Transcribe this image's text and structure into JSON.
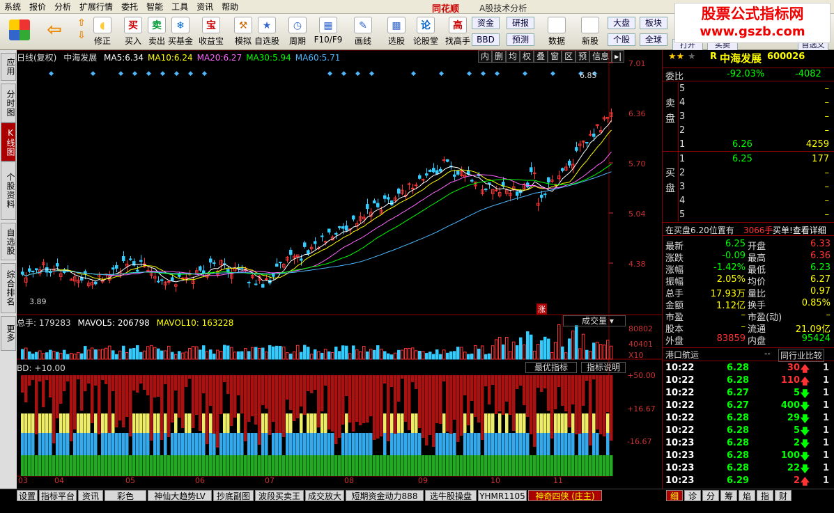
{
  "menu": [
    "系统",
    "报价",
    "分析",
    "扩展行情",
    "委托",
    "智能",
    "工具",
    "资讯",
    "帮助"
  ],
  "brand": "同花顺",
  "title": "A股技术分析",
  "watermark": {
    "line1": "股票公式指标网",
    "line2": "www.gszb.com"
  },
  "toolbar": [
    "修正",
    "买入",
    "卖出",
    "买基金",
    "收益宝",
    "模拟",
    "自选股",
    "周期",
    "F10/F9",
    "画线",
    "选股",
    "论股堂",
    "找高手",
    "数据",
    "新股"
  ],
  "side_buttons": [
    "资金",
    "研报",
    "BBD",
    "预测",
    "大盘",
    "个股",
    "板块",
    "全球",
    "打开",
    "买卖",
    "自选义"
  ],
  "left_tabs": [
    "应用",
    "分时图",
    "K线图",
    "个股资料",
    "自选股",
    "综合排名",
    "更多"
  ],
  "chart": {
    "period": "日线(复权)",
    "stock": "中海发展",
    "ma": [
      {
        "k": "MA5:",
        "v": "6.34",
        "c": "#ffffff"
      },
      {
        "k": "MA10:",
        "v": "6.24",
        "c": "#ffff00"
      },
      {
        "k": "MA20:",
        "v": "6.27",
        "c": "#ff66ff"
      },
      {
        "k": "MA30:",
        "v": "5.94",
        "c": "#00ff00"
      },
      {
        "k": "MA60:",
        "v": "5.71",
        "c": "#4db8ff"
      }
    ],
    "tools": [
      "内",
      "删",
      "均",
      "权",
      "叠",
      "窗",
      "区",
      "预",
      "信息"
    ],
    "price_ticks": [
      "7.01",
      "6.36",
      "5.70",
      "5.04",
      "4.38"
    ],
    "high": "6.85",
    "low": "3.89",
    "vol_label": "总手: 179283",
    "vol_ma5": "MAVOL5: 206798",
    "vol_ma10": "MAVOL10: 163228",
    "vol_btn": "成交量",
    "vol_ticks": [
      "80802",
      "40401",
      "X10"
    ],
    "bd_label": "BD: +10.00",
    "bd_ticks": [
      "+50.00",
      "+16.67",
      "-16.67"
    ],
    "bd_btns": [
      "最优指标",
      "指标说明"
    ],
    "zhang": "涨",
    "months": [
      "03",
      "04",
      "05",
      "06",
      "07",
      "08",
      "09",
      "10",
      "11"
    ]
  },
  "quote": {
    "name": "中海发展",
    "code": "600026",
    "prefix": "R",
    "weibi": {
      "k": "委比",
      "v": "-92.03%",
      "d": "-4082"
    },
    "sell_label": "卖盘",
    "buy_label": "买盘",
    "sell": [
      {
        "n": "5",
        "p": "",
        "v": "–"
      },
      {
        "n": "4",
        "p": "",
        "v": "–"
      },
      {
        "n": "3",
        "p": "",
        "v": "–"
      },
      {
        "n": "2",
        "p": "",
        "v": "–"
      },
      {
        "n": "1",
        "p": "6.26",
        "v": "4259"
      }
    ],
    "buy": [
      {
        "n": "1",
        "p": "6.25",
        "v": "177"
      },
      {
        "n": "2",
        "p": "",
        "v": "–"
      },
      {
        "n": "3",
        "p": "",
        "v": "–"
      },
      {
        "n": "4",
        "p": "",
        "v": "–"
      },
      {
        "n": "5",
        "p": "",
        "v": "–"
      }
    ],
    "notice": {
      "a": "在买盘6.20位置有",
      "b": "3066手",
      "c": "买单!查看详细"
    },
    "stats": [
      {
        "k1": "最新",
        "v1": "6.25",
        "k2": "开盘",
        "v2": "6.33",
        "c1": "#00ff00",
        "c2": "#ff3333"
      },
      {
        "k1": "涨跌",
        "v1": "-0.09",
        "k2": "最高",
        "v2": "6.36",
        "c1": "#00ff00",
        "c2": "#ff3333"
      },
      {
        "k1": "涨幅",
        "v1": "-1.42%",
        "k2": "最低",
        "v2": "6.23",
        "c1": "#00ff00",
        "c2": "#00ff00"
      },
      {
        "k1": "振幅",
        "v1": "2.05%",
        "k2": "均价",
        "v2": "6.27",
        "c1": "#ffff00",
        "c2": "#ffff00"
      },
      {
        "k1": "总手",
        "v1": "17.93万",
        "k2": "量比",
        "v2": "0.97",
        "c1": "#ffff00",
        "c2": "#ffff00"
      },
      {
        "k1": "金额",
        "v1": "1.12亿",
        "k2": "换手",
        "v2": "0.85%",
        "c1": "#ffff00",
        "c2": "#ffff00"
      },
      {
        "k1": "市盈",
        "v1": "–",
        "k2": "市盈(动)",
        "v2": "–",
        "c1": "#ffff00",
        "c2": "#ffff00"
      },
      {
        "k1": "股本",
        "v1": "–",
        "k2": "流通",
        "v2": "21.09亿",
        "c1": "#ffff00",
        "c2": "#ffff00"
      },
      {
        "k1": "外盘",
        "v1": "83859",
        "k2": "内盘",
        "v2": "95424",
        "c1": "#ff3333",
        "c2": "#00ff00"
      }
    ],
    "industry": "港口航运",
    "ind_dash": "--",
    "compare_btn": "同行业比较",
    "ticks": [
      {
        "t": "10:22",
        "p": "6.28",
        "v": "30",
        "d": "up",
        "n": "1"
      },
      {
        "t": "10:22",
        "p": "6.28",
        "v": "110",
        "d": "up",
        "n": "1"
      },
      {
        "t": "10:22",
        "p": "6.27",
        "v": "5",
        "d": "dn",
        "n": "1"
      },
      {
        "t": "10:22",
        "p": "6.27",
        "v": "400",
        "d": "dn",
        "n": "1"
      },
      {
        "t": "10:22",
        "p": "6.28",
        "v": "29",
        "d": "dn",
        "n": "1"
      },
      {
        "t": "10:22",
        "p": "6.28",
        "v": "5",
        "d": "dn",
        "n": "1"
      },
      {
        "t": "10:23",
        "p": "6.28",
        "v": "2",
        "d": "dn",
        "n": "1"
      },
      {
        "t": "10:23",
        "p": "6.28",
        "v": "100",
        "d": "dn",
        "n": "1"
      },
      {
        "t": "10:23",
        "p": "6.28",
        "v": "22",
        "d": "dn",
        "n": "1"
      },
      {
        "t": "10:23",
        "p": "6.29",
        "v": "2",
        "d": "up",
        "n": "1"
      }
    ]
  },
  "bottom_tabs": [
    "设置",
    "指标平台",
    "资讯",
    "彩色MACD",
    "神仙大趋势LV",
    "抄底副图",
    "波段买卖王",
    "成交放大",
    "短期资金动力888",
    "选牛股操盘",
    "YHMR1105",
    "神奇四侠 (庄主)"
  ],
  "bottom_right_tabs": [
    "细",
    "诊",
    "分",
    "筹",
    "焰",
    "指",
    "财"
  ]
}
